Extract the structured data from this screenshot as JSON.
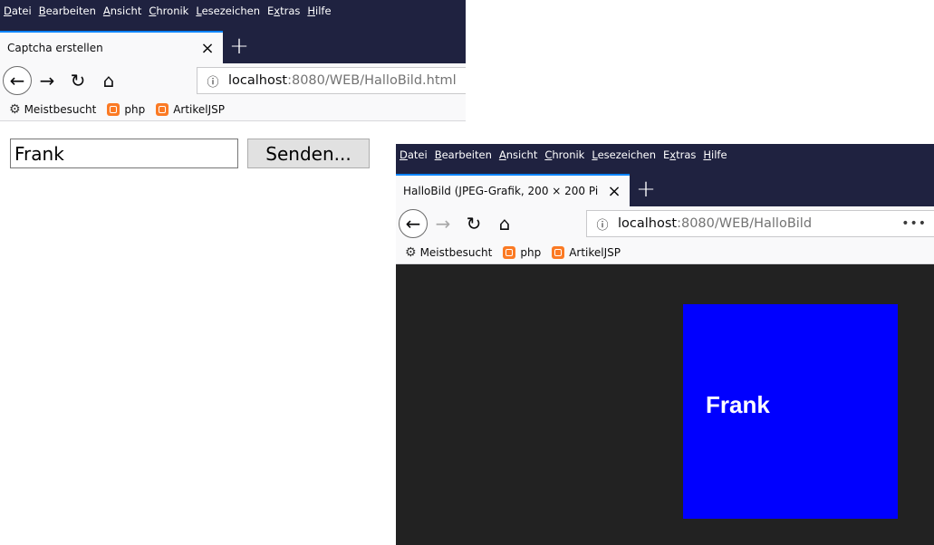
{
  "menu": {
    "items": [
      {
        "acc": "D",
        "rest": "atei"
      },
      {
        "acc": "B",
        "rest": "earbeiten"
      },
      {
        "acc": "A",
        "rest": "nsicht"
      },
      {
        "acc": "C",
        "rest": "hronik"
      },
      {
        "acc": "L",
        "rest": "esezeichen"
      },
      {
        "pre": "E",
        "acc": "x",
        "rest": "tras"
      },
      {
        "acc": "H",
        "rest": "ilfe"
      }
    ]
  },
  "bookmarks": {
    "meistbesucht": "Meistbesucht",
    "php": "php",
    "artikeljsp": "ArtikelJSP"
  },
  "window1": {
    "tab_title": "Captcha erstellen",
    "url_host": "localhost",
    "url_rest": ":8080/WEB/HalloBild.html",
    "name_value": "Frank",
    "send_label": "Senden..."
  },
  "window2": {
    "tab_title": "HalloBild (JPEG-Grafik, 200 × 200 Pi",
    "url_host": "localhost",
    "url_rest": ":8080/WEB/HalloBild",
    "more": "•••",
    "image_text": "Frank",
    "image_color": "#0000ff"
  },
  "icons": {
    "back": "arrow-left-icon",
    "forward": "arrow-right-icon",
    "reload": "reload-icon",
    "home": "home-icon",
    "info": "info-icon",
    "close": "close-icon",
    "new_tab": "plus-icon"
  }
}
